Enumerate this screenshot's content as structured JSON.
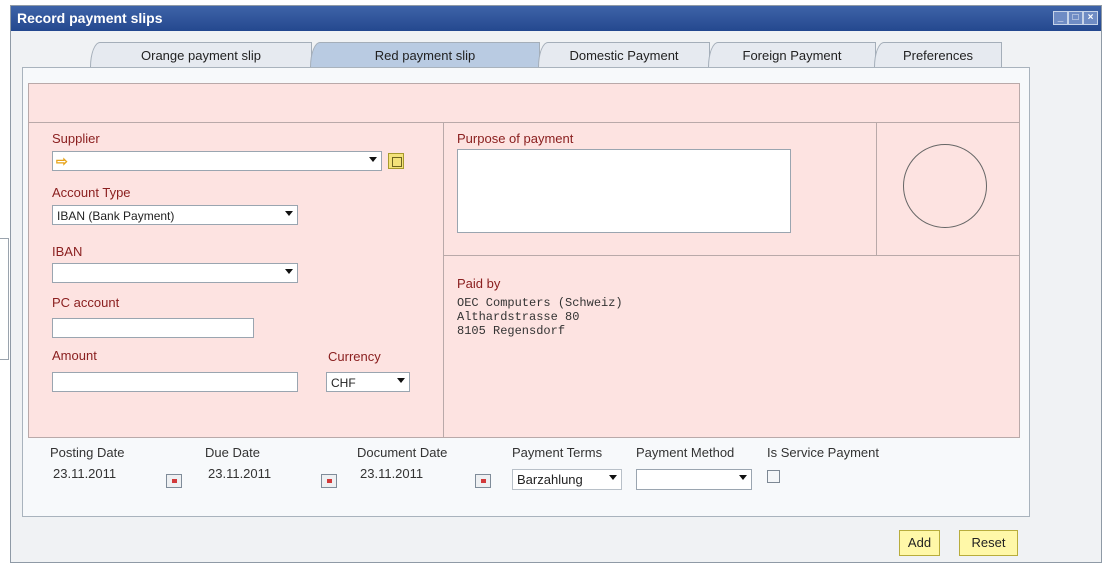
{
  "window": {
    "title": "Record payment slips"
  },
  "window_buttons": [
    "_",
    "□",
    "×"
  ],
  "tabs": [
    {
      "label": "Orange payment slip"
    },
    {
      "label": "Red payment slip"
    },
    {
      "label": "Domestic Payment"
    },
    {
      "label": "Foreign Payment"
    },
    {
      "label": "Preferences"
    }
  ],
  "supplier": {
    "label": "Supplier",
    "value": ""
  },
  "account_type": {
    "label": "Account Type",
    "value": "IBAN (Bank Payment)"
  },
  "iban": {
    "label": "IBAN",
    "value": ""
  },
  "pc_account": {
    "label": "PC account",
    "value": ""
  },
  "amount": {
    "label": "Amount",
    "value": ""
  },
  "currency": {
    "label": "Currency",
    "value": "CHF"
  },
  "purpose": {
    "label": "Purpose of payment",
    "value": ""
  },
  "paid_by": {
    "label": "Paid by",
    "lines": [
      "OEC Computers (Schweiz)",
      "Althardstrasse 80",
      "8105 Regensdorf"
    ]
  },
  "posting_date": {
    "label": "Posting Date",
    "value": "23.11.2011"
  },
  "due_date": {
    "label": "Due Date",
    "value": "23.11.2011"
  },
  "document_date": {
    "label": "Document Date",
    "value": "23.11.2011"
  },
  "payment_terms": {
    "label": "Payment Terms",
    "value": "Barzahlung"
  },
  "payment_method": {
    "label": "Payment Method",
    "value": ""
  },
  "service_payment": {
    "label": "Is Service Payment",
    "checked": false
  },
  "buttons": {
    "add": "Add",
    "reset": "Reset"
  },
  "colors": {
    "pink": "#fde3e1",
    "title_bar": "#2f55a0",
    "label_red": "#8b2020",
    "button_yellow": "#fff8a8"
  },
  "icons": {
    "supplier_arrow": "arrow-right-icon",
    "supplier_lookup": "lookup-icon",
    "calendar": "calendar-icon"
  }
}
